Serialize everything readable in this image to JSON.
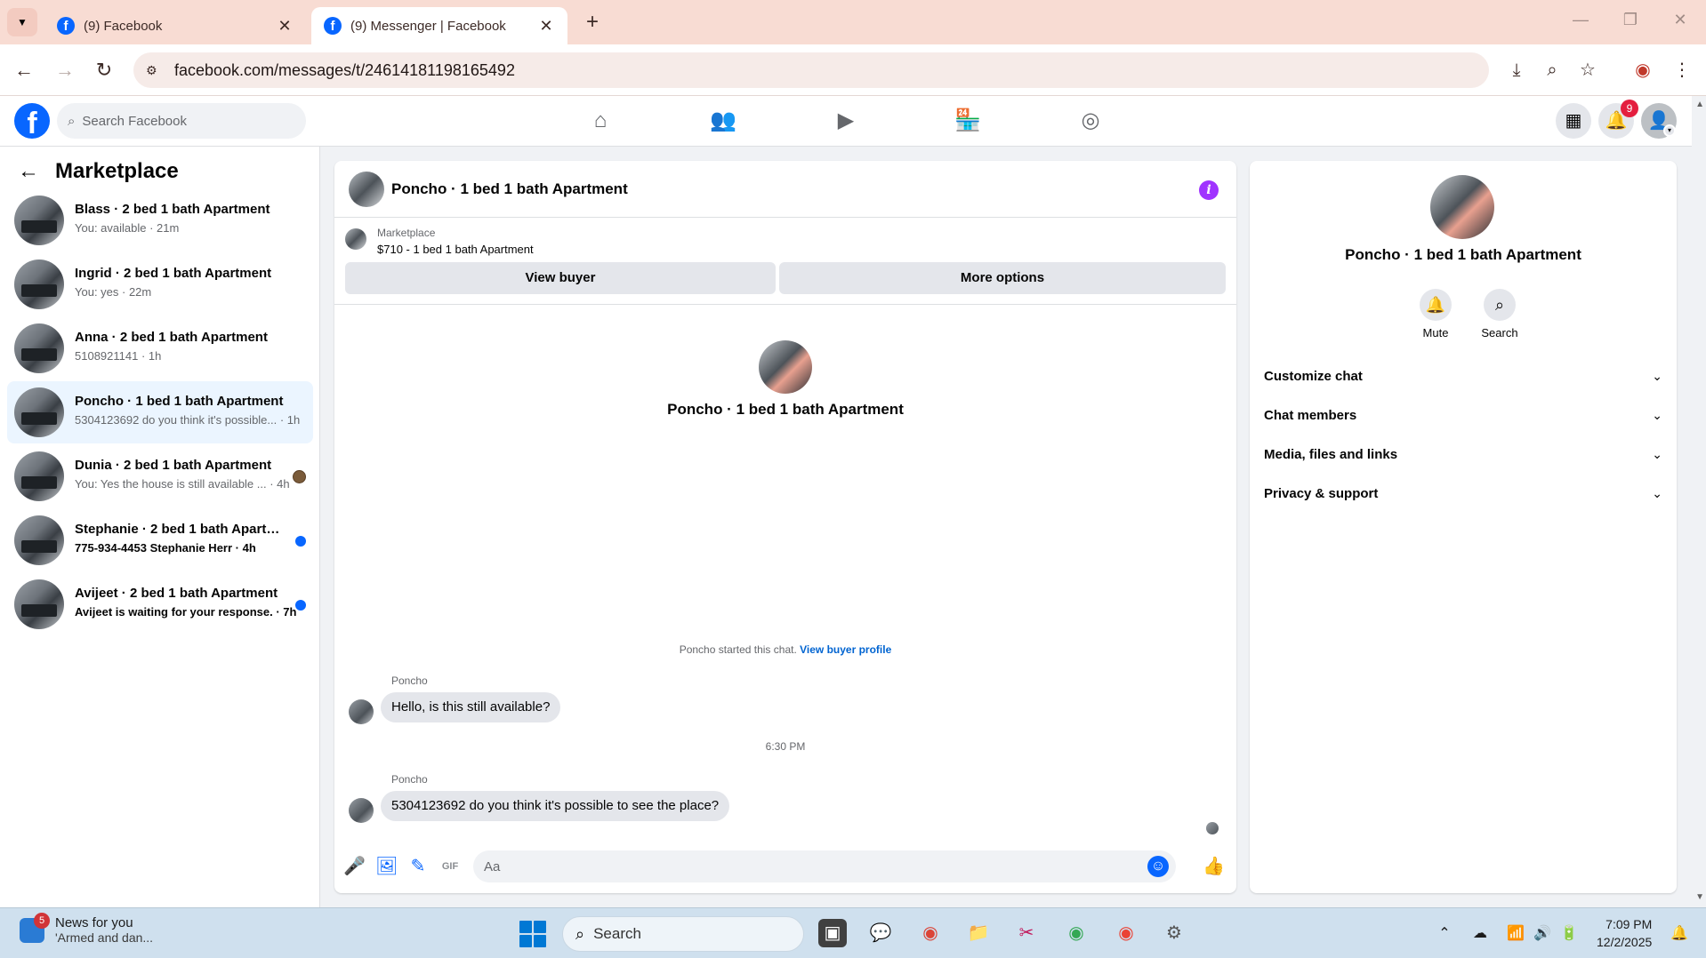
{
  "browser": {
    "tabs": [
      {
        "title": "(9) Facebook",
        "active": false
      },
      {
        "title": "(9) Messenger | Facebook",
        "active": true
      }
    ],
    "url": "facebook.com/messages/t/24614181198165492"
  },
  "header": {
    "search_placeholder": "Search Facebook",
    "notification_count": "9"
  },
  "sidebar": {
    "title": "Marketplace",
    "conversations": [
      {
        "name": "Blass · 2 bed 1 bath Apartment",
        "snippet": "You: available · 21m",
        "unread": false
      },
      {
        "name": "Ingrid · 2 bed 1 bath Apartment",
        "snippet": "You: yes · 22m",
        "unread": false
      },
      {
        "name": "Anna · 2 bed 1 bath Apartment",
        "snippet": "5108921141 · 1h",
        "unread": false
      },
      {
        "name": "Poncho · 1 bed 1 bath Apartment",
        "snippet": "5304123692 do you think it's possible... · 1h",
        "unread": false,
        "selected": true
      },
      {
        "name": "Dunia · 2 bed 1 bath Apartment",
        "snippet": "You: Yes the house is still available ... · 4h",
        "unread": false
      },
      {
        "name": "Stephanie · 2 bed 1 bath Apartm...",
        "snippet": "775-934-4453 Stephanie Herr · 4h",
        "unread": true
      },
      {
        "name": "Avijeet · 2 bed 1 bath Apartment",
        "snippet": "Avijeet is waiting for your response. · 7h",
        "unread": true
      }
    ]
  },
  "chat": {
    "title": "Poncho · 1 bed 1 bath Apartment",
    "listing_category": "Marketplace",
    "listing_price": "$710 - 1 bed 1 bath Apartment",
    "view_buyer_label": "View buyer",
    "more_options_label": "More options",
    "intro_name": "Poncho · 1 bed 1 bath Apartment",
    "started_text": "Poncho started this chat.",
    "view_buyer_profile": "View buyer profile",
    "messages": [
      {
        "sender": "Poncho",
        "text": "Hello, is this still available?"
      },
      {
        "sender": "Poncho",
        "text": "5304123692 do you think it's possible to see the place?"
      }
    ],
    "timestamp": "6:30 PM",
    "composer_placeholder": "Aa"
  },
  "info_panel": {
    "name": "Poncho · 1 bed 1 bath Apartment",
    "mute_label": "Mute",
    "search_label": "Search",
    "sections": [
      "Customize chat",
      "Chat members",
      "Media, files and links",
      "Privacy & support"
    ]
  },
  "taskbar": {
    "news_badge": "5",
    "news_title": "News for you",
    "news_subtitle": "'Armed and dan...",
    "search_label": "Search",
    "time": "7:09 PM",
    "date": "12/2/2025"
  },
  "colors": {
    "fb_blue": "#0866ff",
    "tabbar": "#f8dcd3",
    "info_purple": "#a033ff"
  }
}
